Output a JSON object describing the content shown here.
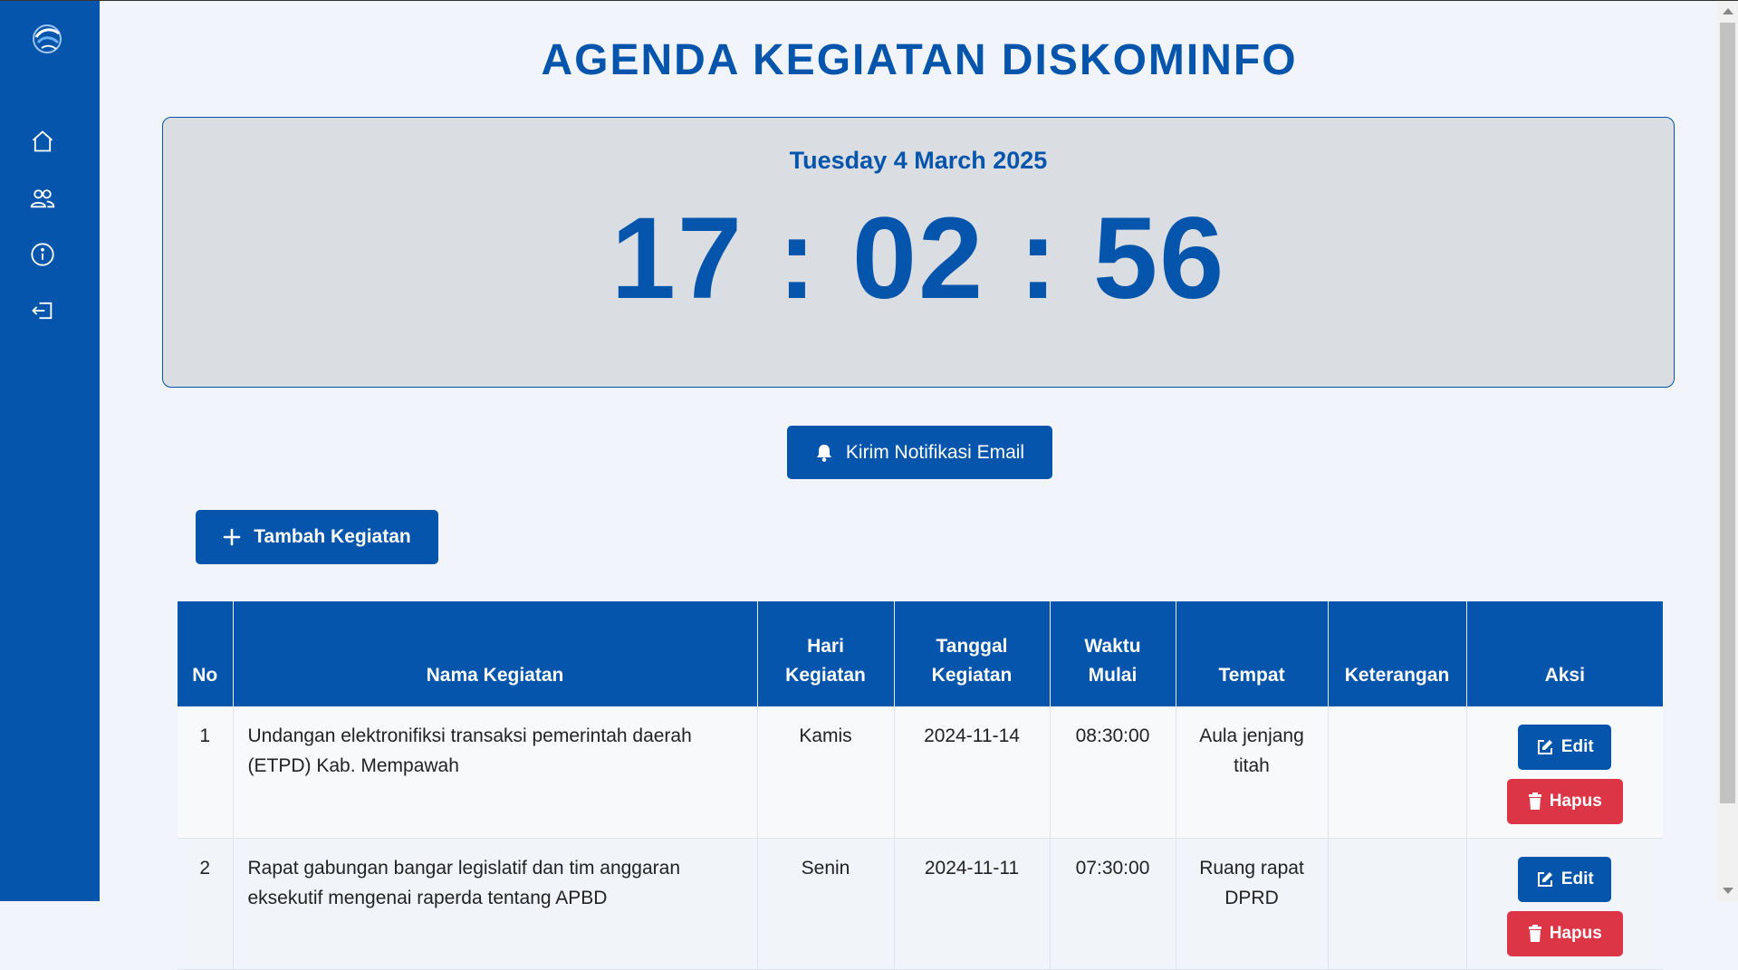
{
  "header": {
    "title": "AGENDA KEGIATAN DISKOMINFO"
  },
  "clock": {
    "date": "Tuesday 4 March 2025",
    "time": "17 : 02 : 56"
  },
  "actions": {
    "notify_label": "Kirim Notifikasi Email",
    "add_label": "Tambah Kegiatan"
  },
  "sidebar": {
    "items": [
      {
        "icon": "home-icon"
      },
      {
        "icon": "users-icon"
      },
      {
        "icon": "info-icon"
      },
      {
        "icon": "logout-icon"
      }
    ]
  },
  "table": {
    "headers": {
      "no": "No",
      "nama": "Nama Kegiatan",
      "hari_1": "Hari",
      "hari_2": "Kegiatan",
      "tanggal_1": "Tanggal",
      "tanggal_2": "Kegiatan",
      "waktu_1": "Waktu",
      "waktu_2": "Mulai",
      "tempat": "Tempat",
      "keterangan": "Keterangan",
      "aksi": "Aksi"
    },
    "rows": [
      {
        "no": "1",
        "nama": "Undangan elektronifiksi transaksi pemerintah daerah (ETPD) Kab. Mempawah",
        "hari": "Kamis",
        "tanggal": "2024-11-14",
        "waktu": "08:30:00",
        "tempat": "Aula jenjang titah",
        "keterangan": "",
        "edit_label": "Edit",
        "delete_label": "Hapus"
      },
      {
        "no": "2",
        "nama": "Rapat gabungan bangar legislatif dan tim anggaran eksekutif mengenai raperda tentang APBD",
        "hari": "Senin",
        "tanggal": "2024-11-11",
        "waktu": "07:30:00",
        "tempat": "Ruang rapat DPRD",
        "keterangan": "",
        "edit_label": "Edit",
        "delete_label": "Hapus"
      }
    ]
  },
  "colors": {
    "primary": "#0455ab",
    "danger": "#dc3545",
    "background": "#f1f5fb",
    "clock_bg": "#dadde2"
  }
}
